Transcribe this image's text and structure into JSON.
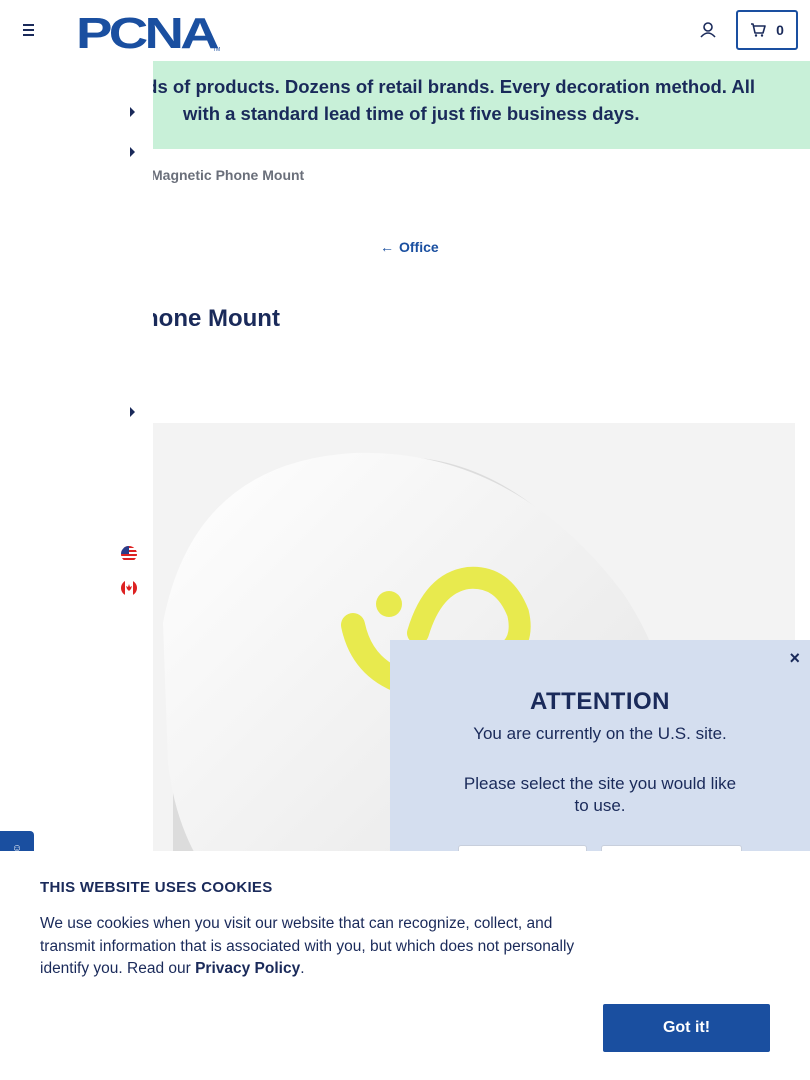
{
  "header": {
    "logo_text": "PCNA",
    "cart_count": "0"
  },
  "banner": {
    "line1": "usands of products. Dozens of retail brands. Every decoration method. All",
    "line2": "with a standard lead time of just five business days."
  },
  "breadcrumb": {
    "current": "Magnetic Phone Mount"
  },
  "back_link": {
    "label": "Office"
  },
  "product": {
    "title": "hone Mount"
  },
  "attention": {
    "close": "×",
    "title": "ATTENTION",
    "current_site": "You are currently on the U.S. site.",
    "select_prompt": "Please select the site you would like to use."
  },
  "cookie": {
    "title": "THIS WEBSITE USES COOKIES",
    "text": "We use cookies when you visit our website that can recognize, collect, and transmit information that is associated with you, but which does not personally identify you. Read our ",
    "link": "Privacy Policy",
    "period": ".",
    "button": "Got it!"
  },
  "colors": {
    "navy": "#1a2a5a",
    "brand_blue": "#1a4fa0",
    "banner_green": "#c8f0d8",
    "modal_blue": "#d4deef",
    "logo_yellow": "#e8ea4e"
  },
  "icons": {
    "menu": "hamburger-icon",
    "account": "user-icon",
    "cart": "cart-icon",
    "back": "arrow-left-icon",
    "us_flag": "us-flag-icon",
    "ca_flag": "canada-flag-icon"
  }
}
